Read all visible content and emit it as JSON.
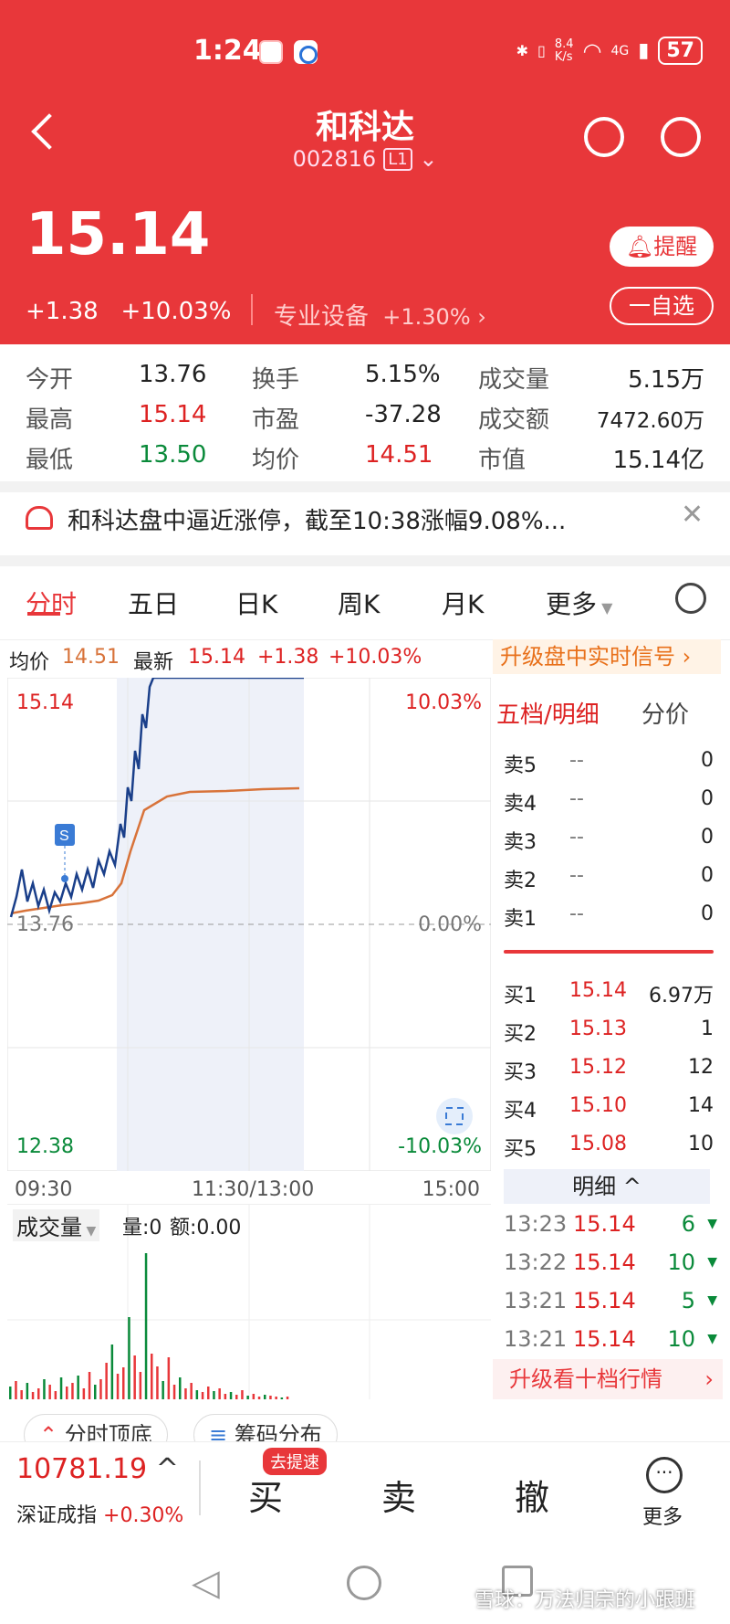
{
  "status_bar": {
    "time": "1:24",
    "net_speed": "8.4\nK/s",
    "signal": "4G",
    "battery": "57"
  },
  "header": {
    "title": "和科达",
    "code": "002816",
    "level": "L1"
  },
  "quote": {
    "price": "15.14",
    "change": "+1.38",
    "change_pct": "+10.03%",
    "sector": "专业设备",
    "sector_pct": "+1.30%",
    "remind_label": "提醒",
    "watch_label": "一自选"
  },
  "stats": {
    "open_label": "今开",
    "open": "13.76",
    "turnover_label": "换手",
    "turnover": "5.15%",
    "volume_label": "成交量",
    "volume": "5.15万",
    "high_label": "最高",
    "high": "15.14",
    "pe_label": "市盈",
    "pe": "-37.28",
    "amount_label": "成交额",
    "amount": "7472.60万",
    "low_label": "最低",
    "low": "13.50",
    "avg_label": "均价",
    "avg": "14.51",
    "mcap_label": "市值",
    "mcap": "15.14亿"
  },
  "notice": {
    "text": "和科达盘中逼近涨停，截至10:38涨幅9.08%..."
  },
  "tabs": [
    "分时",
    "五日",
    "日K",
    "周K",
    "月K",
    "更多"
  ],
  "subbar": {
    "avg_label": "均价",
    "avg": "14.51",
    "latest_label": "最新",
    "latest": "15.14",
    "chg": "+1.38",
    "pct": "+10.03%",
    "upgrade": "升级盘中实时信号"
  },
  "chart": {
    "y_top": "15.14",
    "y_mid": "13.76",
    "y_bot": "12.38",
    "pct_top": "10.03%",
    "pct_mid": "0.00%",
    "pct_bot": "-10.03%",
    "time_start": "09:30",
    "time_mid": "11:30/13:00",
    "time_end": "15:00",
    "signal_mark": "S",
    "price_color": "#1a3f8a",
    "avg_color": "#d8733a"
  },
  "volume": {
    "label": "成交量",
    "qty_label": "量:0",
    "amt_label": "额:0.00"
  },
  "orderbook": {
    "tab1": "五档/明细",
    "tab2": "分价",
    "asks": [
      {
        "label": "卖5",
        "price": "--",
        "vol": "0"
      },
      {
        "label": "卖4",
        "price": "--",
        "vol": "0"
      },
      {
        "label": "卖3",
        "price": "--",
        "vol": "0"
      },
      {
        "label": "卖2",
        "price": "--",
        "vol": "0"
      },
      {
        "label": "卖1",
        "price": "--",
        "vol": "0"
      }
    ],
    "bids": [
      {
        "label": "买1",
        "price": "15.14",
        "vol": "6.97万"
      },
      {
        "label": "买2",
        "price": "15.13",
        "vol": "1"
      },
      {
        "label": "买3",
        "price": "15.12",
        "vol": "12"
      },
      {
        "label": "买4",
        "price": "15.10",
        "vol": "14"
      },
      {
        "label": "买5",
        "price": "15.08",
        "vol": "10"
      }
    ],
    "detail_label": "明细",
    "trades": [
      {
        "time": "13:23",
        "price": "15.14",
        "vol": "6"
      },
      {
        "time": "13:22",
        "price": "15.14",
        "vol": "10"
      },
      {
        "time": "13:21",
        "price": "15.14",
        "vol": "5"
      },
      {
        "time": "13:21",
        "price": "15.14",
        "vol": "10"
      }
    ],
    "upgrade": "升级看十档行情"
  },
  "chips": [
    "分时顶底",
    "筹码分布"
  ],
  "bottom": {
    "index_value": "10781.19",
    "index_name": "深证成指",
    "index_pct": "+0.30%",
    "speed_badge": "去提速",
    "buy": "买",
    "sell": "卖",
    "cancel": "撤",
    "more": "更多"
  },
  "watermark": "雪球：万法归宗的小跟班"
}
